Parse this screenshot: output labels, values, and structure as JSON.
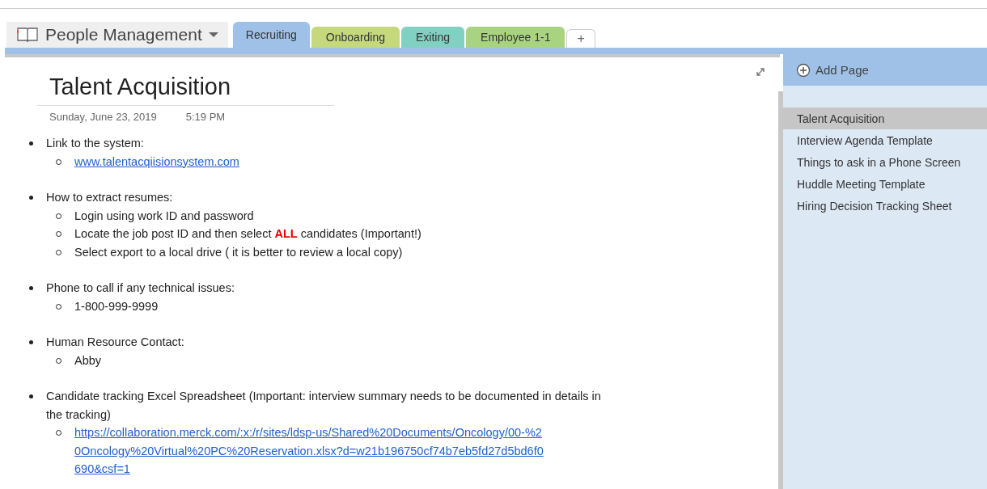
{
  "notebook": {
    "title": "People Management"
  },
  "tabs": [
    {
      "label": "Recruiting",
      "selected": true,
      "color": "#9fc1e7"
    },
    {
      "label": "Onboarding",
      "selected": false,
      "color": "#c5d97c"
    },
    {
      "label": "Exiting",
      "selected": false,
      "color": "#80d1c1"
    },
    {
      "label": "Employee 1-1",
      "selected": false,
      "color": "#a9d47f"
    }
  ],
  "add_tab": {
    "label": "+"
  },
  "page": {
    "title": "Talent Acquisition",
    "date": "Sunday, June 23, 2019",
    "time": "5:19 PM",
    "items": [
      {
        "text": "Link to the system:",
        "children": [
          {
            "kind": "link",
            "segments": [
              {
                "text": "www.talentacqiisionsystem.com",
                "emphasis": false
              }
            ]
          }
        ]
      },
      {
        "text": "How to extract resumes:",
        "children": [
          {
            "kind": "text",
            "segments": [
              {
                "text": "Login using work ID and password",
                "emphasis": false
              }
            ]
          },
          {
            "kind": "text",
            "segments": [
              {
                "text": "Locate the job post ID and then select ",
                "emphasis": false
              },
              {
                "text": "ALL",
                "emphasis": true
              },
              {
                "text": " candidates (Important!)",
                "emphasis": false
              }
            ]
          },
          {
            "kind": "text",
            "segments": [
              {
                "text": "Select export to a local drive ( it is better to review a local copy)",
                "emphasis": false
              }
            ]
          }
        ]
      },
      {
        "text": "Phone to call if any technical issues:",
        "children": [
          {
            "kind": "text",
            "segments": [
              {
                "text": "1-800-999-9999",
                "emphasis": false
              }
            ]
          }
        ]
      },
      {
        "text": "Human Resource Contact:",
        "children": [
          {
            "kind": "text",
            "segments": [
              {
                "text": "Abby",
                "emphasis": false
              }
            ]
          }
        ]
      },
      {
        "text": "Candidate tracking Excel Spreadsheet (Important: interview summary needs to be documented in details in the tracking)",
        "children": [
          {
            "kind": "link",
            "segments": [
              {
                "text": "https://collaboration.merck.com/:x:/r/sites/ldsp-us/Shared%20Documents/Oncology/00-%20Oncology%20Virtual%20PC%20Reservation.xlsx?d=w21b196750cf74b7eb5fd27d5bd6f0690&csf=1",
                "emphasis": false
              }
            ]
          }
        ]
      }
    ]
  },
  "sidebar": {
    "add_page": "Add Page",
    "pages": [
      {
        "label": "Talent Acquisition",
        "selected": true
      },
      {
        "label": "Interview Agenda Template",
        "selected": false
      },
      {
        "label": "Things to ask in a Phone Screen",
        "selected": false
      },
      {
        "label": "Huddle Meeting Template",
        "selected": false
      },
      {
        "label": "Hiring Decision Tracking Sheet",
        "selected": false
      }
    ]
  }
}
